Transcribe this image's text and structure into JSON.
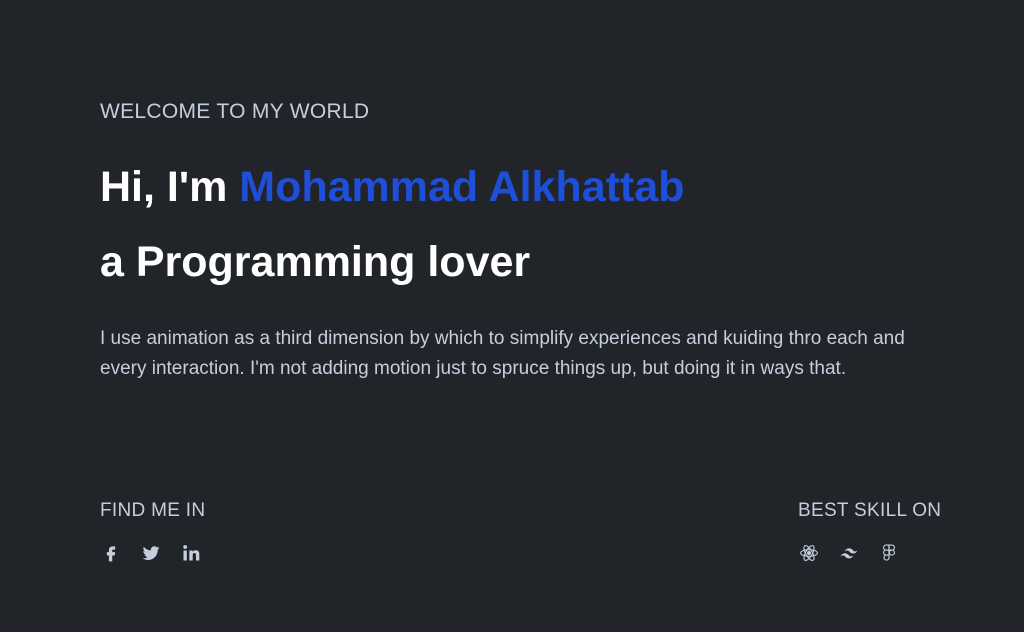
{
  "hero": {
    "eyebrow": "WELCOME TO MY WORLD",
    "greeting": "Hi, I'm ",
    "name": "Mohammad Alkhattab",
    "role_line": "a Programming lover",
    "bio": "I use animation as a third dimension by which to simplify experiences and kuiding thro each and every interaction. I'm not adding motion just to spruce things up, but doing it in ways that."
  },
  "find_me": {
    "title": "FIND ME IN",
    "icons": [
      "facebook-icon",
      "twitter-icon",
      "linkedin-icon"
    ]
  },
  "skills": {
    "title": "BEST SKILL ON",
    "icons": [
      "react-icon",
      "tailwind-icon",
      "figma-icon"
    ]
  },
  "colors": {
    "background": "#212428",
    "accent": "#1f4fd8",
    "text": "#c4cfde",
    "heading": "#ffffff"
  }
}
